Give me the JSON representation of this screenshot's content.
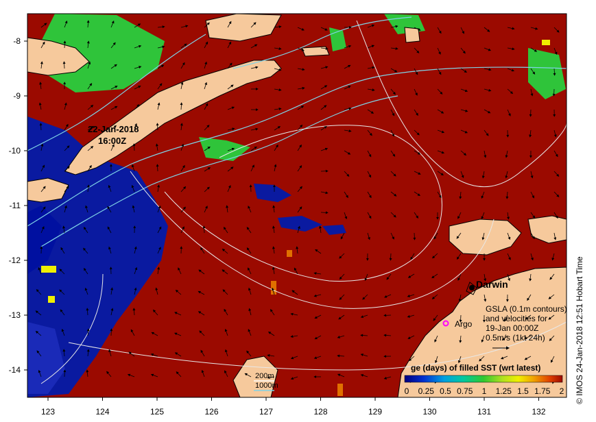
{
  "map": {
    "date_label_line1": "22-Jan-2018",
    "date_label_line2": "16:00Z",
    "city": "Darwin",
    "argo_label": "Argo",
    "gsla_line1": "GSLA (0.1m contours)",
    "gsla_line2": "and velocities for",
    "gsla_line3": "19-Jan 00:00Z",
    "gsla_line4": "0.5m/s (1kt 24h)",
    "depth_200": "200m",
    "depth_1000": "1000m",
    "colorbar_title": "ge (days) of filled SST (wrt latest)",
    "colorbar_ticks": [
      "0",
      "0.25",
      "0.5",
      "0.75",
      "1",
      "1.25",
      "1.5",
      "1.75",
      "2"
    ],
    "x_ticks": [
      "123",
      "124",
      "125",
      "126",
      "127",
      "128",
      "129",
      "130",
      "131",
      "132"
    ],
    "y_ticks": [
      "-8",
      "-9",
      "-10",
      "-11",
      "-12",
      "-13",
      "-14"
    ],
    "credit": "© IMOS 24-Jan-2018 12:51 Hobart Time",
    "colors": {
      "sea": "#9b0a00",
      "land": "#f6c99c",
      "old_blue": "#0a1aa0",
      "green": "#2fc43a",
      "contour": "#7fd3e6"
    }
  }
}
